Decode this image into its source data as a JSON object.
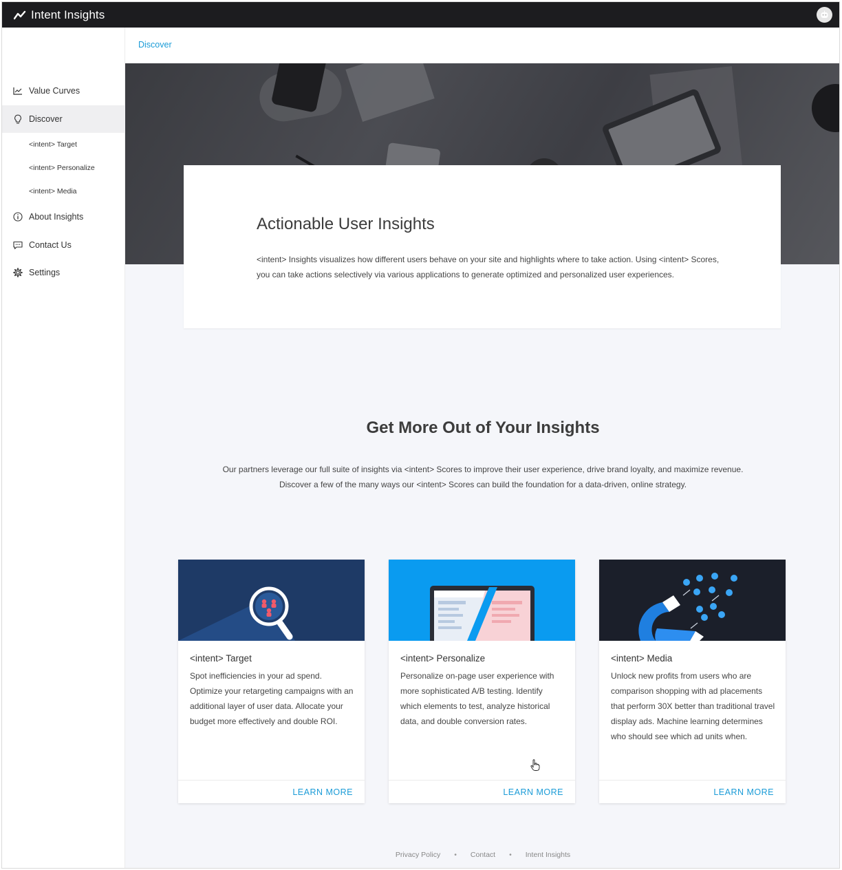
{
  "app": {
    "title": "Intent Insights",
    "brand_icon": "trend-line-icon",
    "avatar_icon": "robot-avatar-icon"
  },
  "sidebar": {
    "items": [
      {
        "label": "Value Curves",
        "icon": "line-chart-icon"
      },
      {
        "label": "Discover",
        "icon": "lightbulb-icon",
        "active": true
      },
      {
        "label": "About Insights",
        "icon": "info-icon"
      },
      {
        "label": "Contact Us",
        "icon": "chat-icon"
      },
      {
        "label": "Settings",
        "icon": "gear-icon"
      }
    ],
    "sub_items": [
      {
        "label": "<intent> Target"
      },
      {
        "label": "<intent> Personalize"
      },
      {
        "label": "<intent> Media"
      }
    ]
  },
  "breadcrumb": {
    "current": "Discover"
  },
  "intro": {
    "title": "Actionable User Insights",
    "text": "<intent> Insights visualizes how different users behave on your site and highlights where to take action. Using <intent> Scores, you can take actions selectively via various applications to generate optimized and personalized user experiences."
  },
  "section": {
    "title": "Get More Out of Your Insights",
    "line1": "Our partners leverage our full suite of insights via <intent> Scores to improve their user experience, drive brand loyalty, and maximize revenue.",
    "line2": "Discover a few of the many ways our <intent> Scores can build the foundation for a data-driven, online strategy."
  },
  "cards": [
    {
      "title": "<intent> Target",
      "text": "Spot inefficiencies in your ad spend. Optimize your retargeting campaigns with an additional layer of user data. Allocate your budget more effectively and double ROI.",
      "cta": "LEARN MORE",
      "image_icon": "magnifier-users-icon",
      "image_bg": "#1e3a66"
    },
    {
      "title": "<intent> Personalize",
      "text": "Personalize on-page user experience with more sophisticated A/B testing. Identify which elements to test, analyze historical data, and double conversion rates.",
      "cta": "LEARN MORE",
      "image_icon": "ab-test-laptop-icon",
      "image_bg": "#0a9bf0"
    },
    {
      "title": "<intent> Media",
      "text": "Unlock new profits from users who are comparison shopping with ad placements that perform 30X better than traditional travel display ads. Machine learning determines who should see which ad units when.",
      "cta": "LEARN MORE",
      "image_icon": "magnet-users-icon",
      "image_bg": "#1b1f2a"
    }
  ],
  "footer": {
    "links": [
      "Privacy Policy",
      "Contact",
      "Intent Insights"
    ],
    "separator": "•"
  },
  "colors": {
    "accent": "#1a9bd7",
    "topbar": "#1c1c1f",
    "page_bg": "#f5f6fa"
  }
}
